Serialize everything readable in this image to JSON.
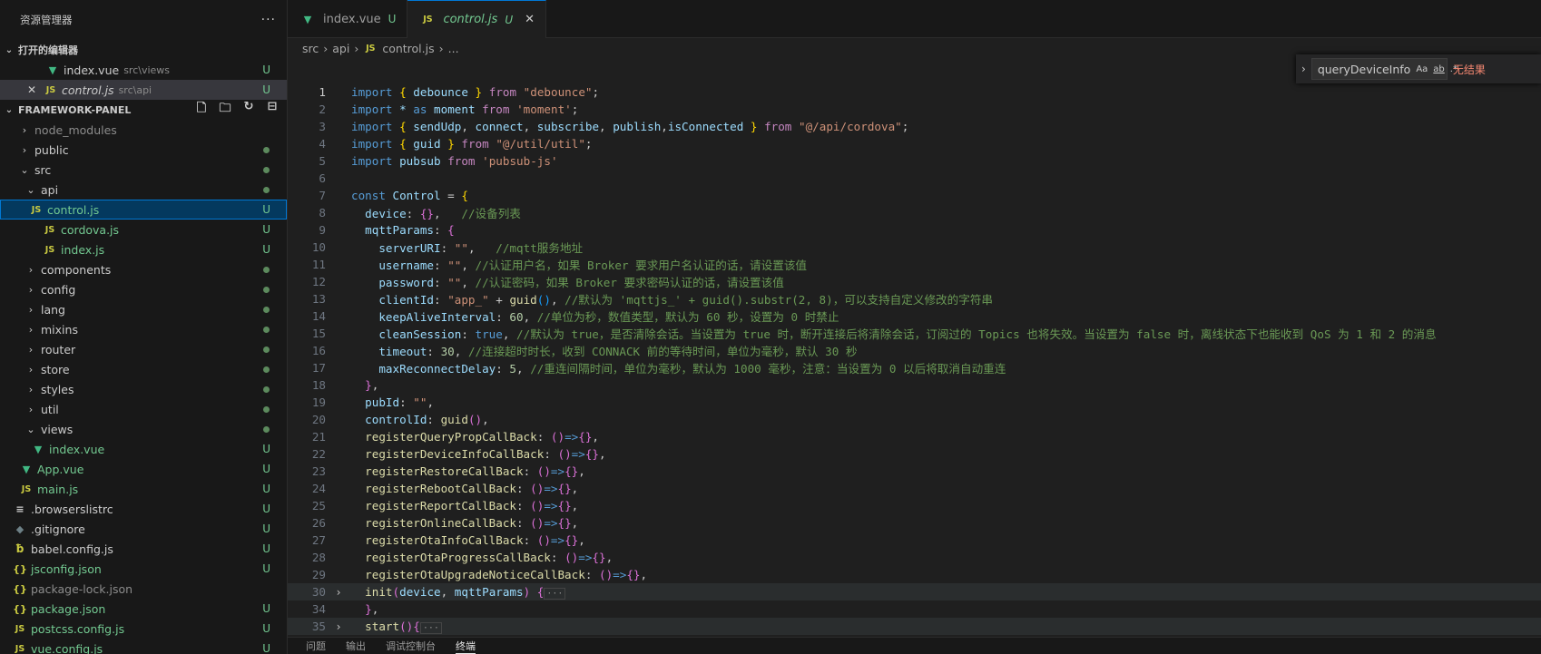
{
  "sidebar": {
    "title": "资源管理器",
    "more": "···",
    "open_editors": {
      "title": "打开的编辑器",
      "items": [
        {
          "name": "index.vue",
          "path": "src\\views",
          "status": "U"
        },
        {
          "name": "control.js",
          "path": "src\\api",
          "status": "U"
        }
      ]
    },
    "workspace": {
      "title": "FRAMEWORK-PANEL",
      "tree": [
        {
          "label": "node_modules",
          "kind": "folder",
          "status": ""
        },
        {
          "label": "public",
          "kind": "folder",
          "status": "dot"
        },
        {
          "label": "src",
          "kind": "folder-open",
          "status": "dot"
        },
        {
          "label": "api",
          "kind": "folder-open",
          "status": "dot"
        },
        {
          "label": "control.js",
          "kind": "js",
          "status": "U"
        },
        {
          "label": "cordova.js",
          "kind": "js",
          "status": "U"
        },
        {
          "label": "index.js",
          "kind": "js",
          "status": "U"
        },
        {
          "label": "components",
          "kind": "folder",
          "status": "dot"
        },
        {
          "label": "config",
          "kind": "folder",
          "status": "dot"
        },
        {
          "label": "lang",
          "kind": "folder",
          "status": "dot"
        },
        {
          "label": "mixins",
          "kind": "folder",
          "status": "dot"
        },
        {
          "label": "router",
          "kind": "folder",
          "status": "dot"
        },
        {
          "label": "store",
          "kind": "folder",
          "status": "dot"
        },
        {
          "label": "styles",
          "kind": "folder",
          "status": "dot"
        },
        {
          "label": "util",
          "kind": "folder",
          "status": "dot"
        },
        {
          "label": "views",
          "kind": "folder-open",
          "status": "dot"
        },
        {
          "label": "index.vue",
          "kind": "vue",
          "status": "U"
        },
        {
          "label": "App.vue",
          "kind": "vue",
          "status": "U"
        },
        {
          "label": "main.js",
          "kind": "js",
          "status": "U"
        },
        {
          "label": ".browserslistrc",
          "kind": "list",
          "status": "U"
        },
        {
          "label": ".gitignore",
          "kind": "git",
          "status": "U"
        },
        {
          "label": "babel.config.js",
          "kind": "babel",
          "status": "U"
        },
        {
          "label": "jsconfig.json",
          "kind": "json",
          "status": "U"
        },
        {
          "label": "package-lock.json",
          "kind": "json",
          "status": ""
        },
        {
          "label": "package.json",
          "kind": "json",
          "status": "U"
        },
        {
          "label": "postcss.config.js",
          "kind": "js",
          "status": "U"
        },
        {
          "label": "vue.config.js",
          "kind": "js",
          "status": "U"
        }
      ]
    }
  },
  "tabs": [
    {
      "label": "index.vue",
      "status": "U"
    },
    {
      "label": "control.js",
      "status": "U",
      "close": "✕"
    }
  ],
  "breadcrumb": {
    "a": "src",
    "b": "api",
    "c": "control.js",
    "d": "..."
  },
  "find": {
    "value": "queryDeviceInfo",
    "opt1": "Aa",
    "opt2": "ab",
    "opt3": ".*",
    "result": "无结果"
  },
  "panel_tabs": [
    "问题",
    "输出",
    "调试控制台",
    "终端"
  ],
  "code_lines": [
    {
      "n": "1",
      "parts": [
        [
          "k",
          "import"
        ],
        [
          "t",
          " "
        ],
        [
          "b1",
          "{"
        ],
        [
          "t",
          " "
        ],
        [
          "v",
          "debounce"
        ],
        [
          "t",
          " "
        ],
        [
          "b1",
          "}"
        ],
        [
          "t",
          " "
        ],
        [
          "kw",
          "from"
        ],
        [
          "t",
          " "
        ],
        [
          "s",
          "\"debounce\""
        ],
        [
          "t",
          ";"
        ]
      ]
    },
    {
      "n": "2",
      "parts": [
        [
          "k",
          "import"
        ],
        [
          "t",
          " "
        ],
        [
          "v",
          "*"
        ],
        [
          "t",
          " "
        ],
        [
          "k",
          "as"
        ],
        [
          "t",
          " "
        ],
        [
          "v",
          "moment"
        ],
        [
          "t",
          " "
        ],
        [
          "kw",
          "from"
        ],
        [
          "t",
          " "
        ],
        [
          "s",
          "'moment'"
        ],
        [
          "t",
          ";"
        ]
      ]
    },
    {
      "n": "3",
      "parts": [
        [
          "k",
          "import"
        ],
        [
          "t",
          " "
        ],
        [
          "b1",
          "{"
        ],
        [
          "t",
          " "
        ],
        [
          "v",
          "sendUdp"
        ],
        [
          "t",
          ", "
        ],
        [
          "v",
          "connect"
        ],
        [
          "t",
          ", "
        ],
        [
          "v",
          "subscribe"
        ],
        [
          "t",
          ", "
        ],
        [
          "v",
          "publish"
        ],
        [
          "t",
          ","
        ],
        [
          "v",
          "isConnected"
        ],
        [
          "t",
          " "
        ],
        [
          "b1",
          "}"
        ],
        [
          "t",
          " "
        ],
        [
          "kw",
          "from"
        ],
        [
          "t",
          " "
        ],
        [
          "s",
          "\"@/api/cordova\""
        ],
        [
          "t",
          ";"
        ]
      ]
    },
    {
      "n": "4",
      "parts": [
        [
          "k",
          "import"
        ],
        [
          "t",
          " "
        ],
        [
          "b1",
          "{"
        ],
        [
          "t",
          " "
        ],
        [
          "v",
          "guid"
        ],
        [
          "t",
          " "
        ],
        [
          "b1",
          "}"
        ],
        [
          "t",
          " "
        ],
        [
          "kw",
          "from"
        ],
        [
          "t",
          " "
        ],
        [
          "s",
          "\"@/util/util\""
        ],
        [
          "t",
          ";"
        ]
      ]
    },
    {
      "n": "5",
      "parts": [
        [
          "k",
          "import"
        ],
        [
          "t",
          " "
        ],
        [
          "v",
          "pubsub"
        ],
        [
          "t",
          " "
        ],
        [
          "kw",
          "from"
        ],
        [
          "t",
          " "
        ],
        [
          "s",
          "'pubsub-js'"
        ]
      ]
    },
    {
      "n": "6",
      "parts": []
    },
    {
      "n": "7",
      "parts": [
        [
          "k",
          "const"
        ],
        [
          "t",
          " "
        ],
        [
          "v",
          "Control"
        ],
        [
          "t",
          " = "
        ],
        [
          "b1",
          "{"
        ]
      ]
    },
    {
      "n": "8",
      "parts": [
        [
          "t",
          "  "
        ],
        [
          "v",
          "device"
        ],
        [
          "t",
          ": "
        ],
        [
          "b2",
          "{}"
        ],
        [
          "t",
          ",   "
        ],
        [
          "c",
          "//设备列表"
        ]
      ]
    },
    {
      "n": "9",
      "parts": [
        [
          "t",
          "  "
        ],
        [
          "v",
          "mqttParams"
        ],
        [
          "t",
          ": "
        ],
        [
          "b2",
          "{"
        ]
      ]
    },
    {
      "n": "10",
      "parts": [
        [
          "t",
          "    "
        ],
        [
          "v",
          "serverURI"
        ],
        [
          "t",
          ": "
        ],
        [
          "s",
          "\"\""
        ],
        [
          "t",
          ",   "
        ],
        [
          "c",
          "//mqtt服务地址"
        ]
      ]
    },
    {
      "n": "11",
      "parts": [
        [
          "t",
          "    "
        ],
        [
          "v",
          "username"
        ],
        [
          "t",
          ": "
        ],
        [
          "s",
          "\"\""
        ],
        [
          "t",
          ", "
        ],
        [
          "c",
          "//认证用户名，如果 Broker 要求用户名认证的话，请设置该值"
        ]
      ]
    },
    {
      "n": "12",
      "parts": [
        [
          "t",
          "    "
        ],
        [
          "v",
          "password"
        ],
        [
          "t",
          ": "
        ],
        [
          "s",
          "\"\""
        ],
        [
          "t",
          ", "
        ],
        [
          "c",
          "//认证密码，如果 Broker 要求密码认证的话，请设置该值"
        ]
      ]
    },
    {
      "n": "13",
      "parts": [
        [
          "t",
          "    "
        ],
        [
          "v",
          "clientId"
        ],
        [
          "t",
          ": "
        ],
        [
          "s",
          "\"app_\""
        ],
        [
          "t",
          " + "
        ],
        [
          "f",
          "guid"
        ],
        [
          "b3",
          "()"
        ],
        [
          "t",
          ", "
        ],
        [
          "c",
          "//默认为 'mqttjs_' + guid().substr(2, 8)，可以支持自定义修改的字符串"
        ]
      ]
    },
    {
      "n": "14",
      "parts": [
        [
          "t",
          "    "
        ],
        [
          "v",
          "keepAliveInterval"
        ],
        [
          "t",
          ": "
        ],
        [
          "n",
          "60"
        ],
        [
          "t",
          ", "
        ],
        [
          "c",
          "//单位为秒，数值类型，默认为 60 秒，设置为 0 时禁止"
        ]
      ]
    },
    {
      "n": "15",
      "parts": [
        [
          "t",
          "    "
        ],
        [
          "v",
          "cleanSession"
        ],
        [
          "t",
          ": "
        ],
        [
          "k",
          "true"
        ],
        [
          "t",
          ", "
        ],
        [
          "c",
          "//默认为 true，是否清除会话。当设置为 true 时，断开连接后将清除会话，订阅过的 Topics 也将失效。当设置为 false 时，离线状态下也能收到 QoS 为 1 和 2 的消息"
        ]
      ]
    },
    {
      "n": "16",
      "parts": [
        [
          "t",
          "    "
        ],
        [
          "v",
          "timeout"
        ],
        [
          "t",
          ": "
        ],
        [
          "n",
          "30"
        ],
        [
          "t",
          ", "
        ],
        [
          "c",
          "//连接超时时长，收到 CONNACK 前的等待时间，单位为毫秒，默认 30 秒"
        ]
      ]
    },
    {
      "n": "17",
      "parts": [
        [
          "t",
          "    "
        ],
        [
          "v",
          "maxReconnectDelay"
        ],
        [
          "t",
          ": "
        ],
        [
          "n",
          "5"
        ],
        [
          "t",
          ", "
        ],
        [
          "c",
          "//重连间隔时间，单位为毫秒，默认为 1000 毫秒，注意：当设置为 0 以后将取消自动重连"
        ]
      ]
    },
    {
      "n": "18",
      "parts": [
        [
          "t",
          "  "
        ],
        [
          "b2",
          "}"
        ],
        [
          "t",
          ","
        ]
      ]
    },
    {
      "n": "19",
      "parts": [
        [
          "t",
          "  "
        ],
        [
          "v",
          "pubId"
        ],
        [
          "t",
          ": "
        ],
        [
          "s",
          "\"\""
        ],
        [
          "t",
          ","
        ]
      ]
    },
    {
      "n": "20",
      "parts": [
        [
          "t",
          "  "
        ],
        [
          "v",
          "controlId"
        ],
        [
          "t",
          ": "
        ],
        [
          "f",
          "guid"
        ],
        [
          "b2",
          "()"
        ],
        [
          "t",
          ","
        ]
      ]
    },
    {
      "n": "21",
      "parts": [
        [
          "t",
          "  "
        ],
        [
          "f",
          "registerQueryPropCallBack"
        ],
        [
          "t",
          ": "
        ],
        [
          "b2",
          "()"
        ],
        [
          "k",
          "=>"
        ],
        [
          "b2",
          "{}"
        ],
        [
          "t",
          ","
        ]
      ]
    },
    {
      "n": "22",
      "parts": [
        [
          "t",
          "  "
        ],
        [
          "f",
          "registerDeviceInfoCallBack"
        ],
        [
          "t",
          ": "
        ],
        [
          "b2",
          "()"
        ],
        [
          "k",
          "=>"
        ],
        [
          "b2",
          "{}"
        ],
        [
          "t",
          ","
        ]
      ]
    },
    {
      "n": "23",
      "parts": [
        [
          "t",
          "  "
        ],
        [
          "f",
          "registerRestoreCallBack"
        ],
        [
          "t",
          ": "
        ],
        [
          "b2",
          "()"
        ],
        [
          "k",
          "=>"
        ],
        [
          "b2",
          "{}"
        ],
        [
          "t",
          ","
        ]
      ]
    },
    {
      "n": "24",
      "parts": [
        [
          "t",
          "  "
        ],
        [
          "f",
          "registerRebootCallBack"
        ],
        [
          "t",
          ": "
        ],
        [
          "b2",
          "()"
        ],
        [
          "k",
          "=>"
        ],
        [
          "b2",
          "{}"
        ],
        [
          "t",
          ","
        ]
      ]
    },
    {
      "n": "25",
      "parts": [
        [
          "t",
          "  "
        ],
        [
          "f",
          "registerReportCallBack"
        ],
        [
          "t",
          ": "
        ],
        [
          "b2",
          "()"
        ],
        [
          "k",
          "=>"
        ],
        [
          "b2",
          "{}"
        ],
        [
          "t",
          ","
        ]
      ]
    },
    {
      "n": "26",
      "parts": [
        [
          "t",
          "  "
        ],
        [
          "f",
          "registerOnlineCallBack"
        ],
        [
          "t",
          ": "
        ],
        [
          "b2",
          "()"
        ],
        [
          "k",
          "=>"
        ],
        [
          "b2",
          "{}"
        ],
        [
          "t",
          ","
        ]
      ]
    },
    {
      "n": "27",
      "parts": [
        [
          "t",
          "  "
        ],
        [
          "f",
          "registerOtaInfoCallBack"
        ],
        [
          "t",
          ": "
        ],
        [
          "b2",
          "()"
        ],
        [
          "k",
          "=>"
        ],
        [
          "b2",
          "{}"
        ],
        [
          "t",
          ","
        ]
      ]
    },
    {
      "n": "28",
      "parts": [
        [
          "t",
          "  "
        ],
        [
          "f",
          "registerOtaProgressCallBack"
        ],
        [
          "t",
          ": "
        ],
        [
          "b2",
          "()"
        ],
        [
          "k",
          "=>"
        ],
        [
          "b2",
          "{}"
        ],
        [
          "t",
          ","
        ]
      ]
    },
    {
      "n": "29",
      "parts": [
        [
          "t",
          "  "
        ],
        [
          "f",
          "registerOtaUpgradeNoticeCallBack"
        ],
        [
          "t",
          ": "
        ],
        [
          "b2",
          "()"
        ],
        [
          "k",
          "=>"
        ],
        [
          "b2",
          "{}"
        ],
        [
          "t",
          ","
        ]
      ]
    },
    {
      "n": "30",
      "fold": "›",
      "hl": true,
      "parts": [
        [
          "t",
          "  "
        ],
        [
          "f",
          "init"
        ],
        [
          "b2",
          "("
        ],
        [
          "v",
          "device"
        ],
        [
          "t",
          ", "
        ],
        [
          "v",
          "mqttParams"
        ],
        [
          "b2",
          ")"
        ],
        [
          "t",
          " "
        ],
        [
          "b2",
          "{"
        ],
        [
          "ell",
          "···"
        ]
      ]
    },
    {
      "n": "34",
      "parts": [
        [
          "t",
          "  "
        ],
        [
          "b2",
          "}"
        ],
        [
          "t",
          ","
        ]
      ]
    },
    {
      "n": "35",
      "fold": "›",
      "hl": true,
      "parts": [
        [
          "t",
          "  "
        ],
        [
          "f",
          "start"
        ],
        [
          "b2",
          "()"
        ],
        [
          "b2",
          "{"
        ],
        [
          "ell",
          "···"
        ]
      ]
    }
  ]
}
